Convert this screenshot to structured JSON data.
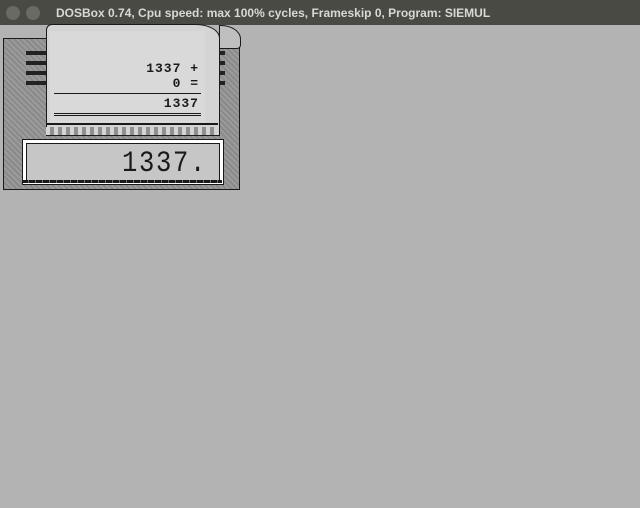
{
  "titlebar": {
    "title": "DOSBox 0.74, Cpu speed: max 100% cycles, Frameskip  0, Program:   SIEMUL"
  },
  "tape": {
    "lines": [
      {
        "text": "1337 +"
      },
      {
        "text": "0 ="
      },
      {
        "text": "1337  "
      }
    ]
  },
  "lcd": {
    "display": "1337."
  }
}
